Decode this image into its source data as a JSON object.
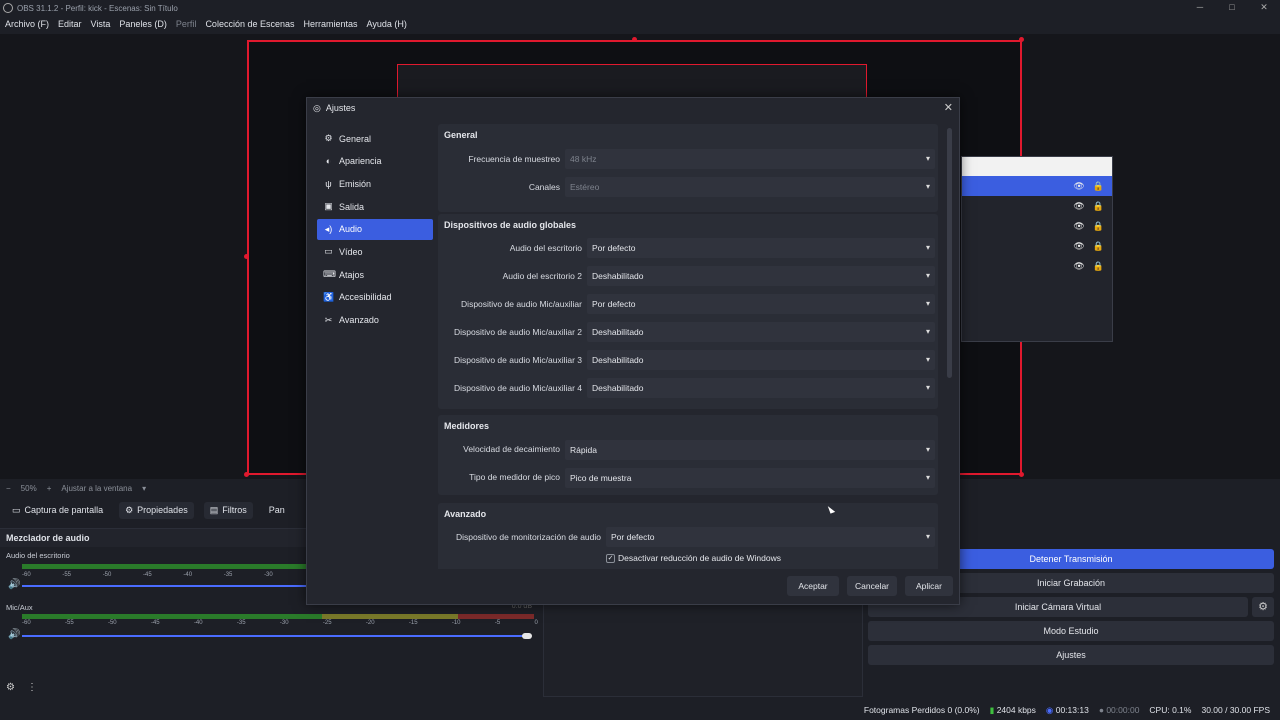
{
  "window": {
    "title": "OBS 31.1.2 - Perfil: kick - Escenas: Sin Título",
    "controls": [
      "─",
      "□",
      "✕"
    ]
  },
  "menu": [
    "Archivo (F)",
    "Editar",
    "Vista",
    "Paneles (D)",
    "Perfil",
    "Colección de Escenas",
    "Herramientas",
    "Ayuda (H)"
  ],
  "zoom": {
    "minus": "−",
    "level": "50%",
    "plus": "+",
    "fit": "Ajustar a la ventana"
  },
  "source_toolbar": {
    "source": "Captura de pantalla",
    "properties": "Propiedades",
    "filters": "Filtros",
    "more": "Pan"
  },
  "mixer": {
    "title": "Mezclador de audio",
    "channels": [
      {
        "name": "Audio del escritorio",
        "ticks": [
          "-60",
          "-55",
          "-50",
          "-45",
          "-40",
          "-35",
          "-30"
        ]
      },
      {
        "name": "Mic/Aux",
        "ticks": [
          "-60",
          "-55",
          "-50",
          "-45",
          "-40",
          "-35",
          "-30",
          "-25",
          "-20",
          "-15",
          "-10",
          "-5",
          "0"
        ],
        "db": "0.0 dB"
      }
    ]
  },
  "controls_dock": {
    "buttons": [
      "Detener Transmisión",
      "Iniciar Grabación",
      "Iniciar Cámara Virtual",
      "Modo Estudio",
      "Ajustes"
    ]
  },
  "statusbar": {
    "dropped": "Fotogramas Perdidos 0 (0.0%)",
    "bitrate": "2404 kbps",
    "stream_time": "00:13:13",
    "rec_time": "00:00:00",
    "cpu": "CPU: 0.1%",
    "fps": "30.00 / 30.00 FPS"
  },
  "dialog": {
    "title": "Ajustes",
    "close": "✕",
    "sidebar": [
      "General",
      "Apariencia",
      "Emisión",
      "Salida",
      "Audio",
      "Vídeo",
      "Atajos",
      "Accesibilidad",
      "Avanzado"
    ],
    "active": "Audio",
    "sections": {
      "general": {
        "title": "General",
        "sample_rate_label": "Frecuencia de muestreo",
        "sample_rate": "48 kHz",
        "channels_label": "Canales",
        "channels": "Estéreo"
      },
      "global_devices": {
        "title": "Dispositivos de audio globales",
        "rows": [
          {
            "label": "Audio del escritorio",
            "value": "Por defecto"
          },
          {
            "label": "Audio del escritorio 2",
            "value": "Deshabilitado"
          },
          {
            "label": "Dispositivo de audio Mic/auxiliar",
            "value": "Por defecto"
          },
          {
            "label": "Dispositivo de audio Mic/auxiliar 2",
            "value": "Deshabilitado"
          },
          {
            "label": "Dispositivo de audio Mic/auxiliar 3",
            "value": "Deshabilitado"
          },
          {
            "label": "Dispositivo de audio Mic/auxiliar 4",
            "value": "Deshabilitado"
          }
        ]
      },
      "meters": {
        "title": "Medidores",
        "decay_label": "Velocidad de decaimiento",
        "decay": "Rápida",
        "peak_label": "Tipo de medidor de pico",
        "peak": "Pico de muestra"
      },
      "advanced": {
        "title": "Avanzado",
        "monitor_label": "Dispositivo de monitorización de audio",
        "monitor": "Por defecto",
        "ducking": "Desactivar reducción de audio de Windows",
        "ducking_checked": true
      }
    },
    "buttons": {
      "ok": "Aceptar",
      "cancel": "Cancelar",
      "apply": "Aplicar"
    }
  },
  "colors": {
    "accent": "#3b5ee0",
    "preview_border": "#e0192e"
  }
}
